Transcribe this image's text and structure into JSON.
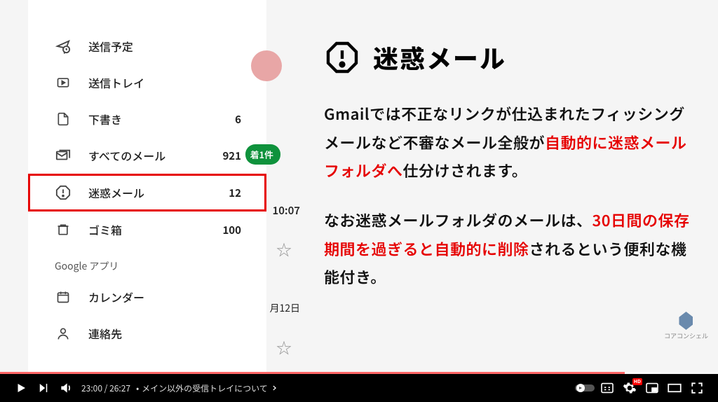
{
  "sidebar": {
    "items": [
      {
        "label": "送信予定",
        "count": ""
      },
      {
        "label": "送信トレイ",
        "count": ""
      },
      {
        "label": "下書き",
        "count": "6"
      },
      {
        "label": "すべてのメール",
        "count": "921"
      },
      {
        "label": "迷惑メール",
        "count": "12"
      },
      {
        "label": "ゴミ箱",
        "count": "100"
      }
    ],
    "section_label": "Google アプリ",
    "apps": [
      {
        "label": "カレンダー"
      },
      {
        "label": "連絡先"
      }
    ]
  },
  "badge": "着1件",
  "peek_time": "10:07",
  "peek_date": "月12日",
  "title": "迷惑メール",
  "paragraphs": {
    "p1_a": "Gmailでは不正なリンクが仕込まれたフィッシングメールなど不審なメール全般が",
    "p1_red": "自動的に迷惑メールフォルダへ",
    "p1_b": "仕分けされます。",
    "p2_a": "なお迷惑メールフォルダのメールは、",
    "p2_red": "30日間の保存期間を過ぎると自動的に削除",
    "p2_b": "されるという便利な機能付き。"
  },
  "logo_label": "コアコンシェル",
  "player": {
    "current_time": "23:00",
    "duration": "26:27",
    "chapter": "メイン以外の受信トレイについて",
    "progress_pct": 87,
    "buffer_pct": 92,
    "hd": "HD"
  }
}
